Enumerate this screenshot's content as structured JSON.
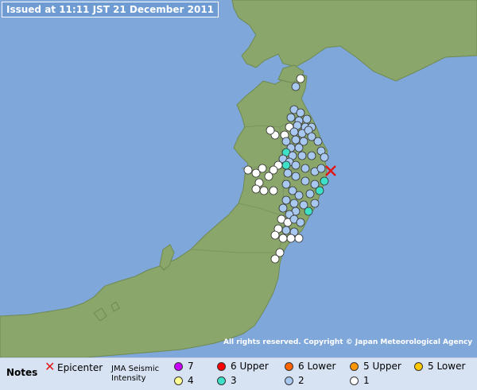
{
  "header": {
    "issued": "Issued at 11:11 JST  21 December 2011"
  },
  "footer": {
    "copyright": "All rights reserved. Copyright © Japan Meteorological Agency"
  },
  "colors": {
    "sea": "#7fa7da",
    "land": "#8aa66a",
    "intensity_1": "#ffffff",
    "intensity_2": "#a8c8f0",
    "intensity_3": "#3ee0c8",
    "intensity_4": "#ffff96",
    "intensity_5_lower": "#ffc800",
    "intensity_5_upper": "#ff9600",
    "intensity_6_lower": "#ff6400",
    "intensity_6_upper": "#ff0000",
    "intensity_7": "#c800ff",
    "epicenter": "#e01818"
  },
  "legend": {
    "notes_label": "Notes",
    "epicenter_label": "Epicenter",
    "scale_label_line1": "JMA Seismic",
    "scale_label_line2": "Intensity",
    "items": [
      {
        "label": "7",
        "color": "#c800ff"
      },
      {
        "label": "6 Upper",
        "color": "#ff0000"
      },
      {
        "label": "6 Lower",
        "color": "#ff6400"
      },
      {
        "label": "5 Upper",
        "color": "#ff9600"
      },
      {
        "label": "5 Lower",
        "color": "#ffc800"
      },
      {
        "label": "4",
        "color": "#ffff96"
      },
      {
        "label": "3",
        "color": "#3ee0c8"
      },
      {
        "label": "2",
        "color": "#a8c8f0"
      },
      {
        "label": "1",
        "color": "#ffffff"
      }
    ]
  }
}
